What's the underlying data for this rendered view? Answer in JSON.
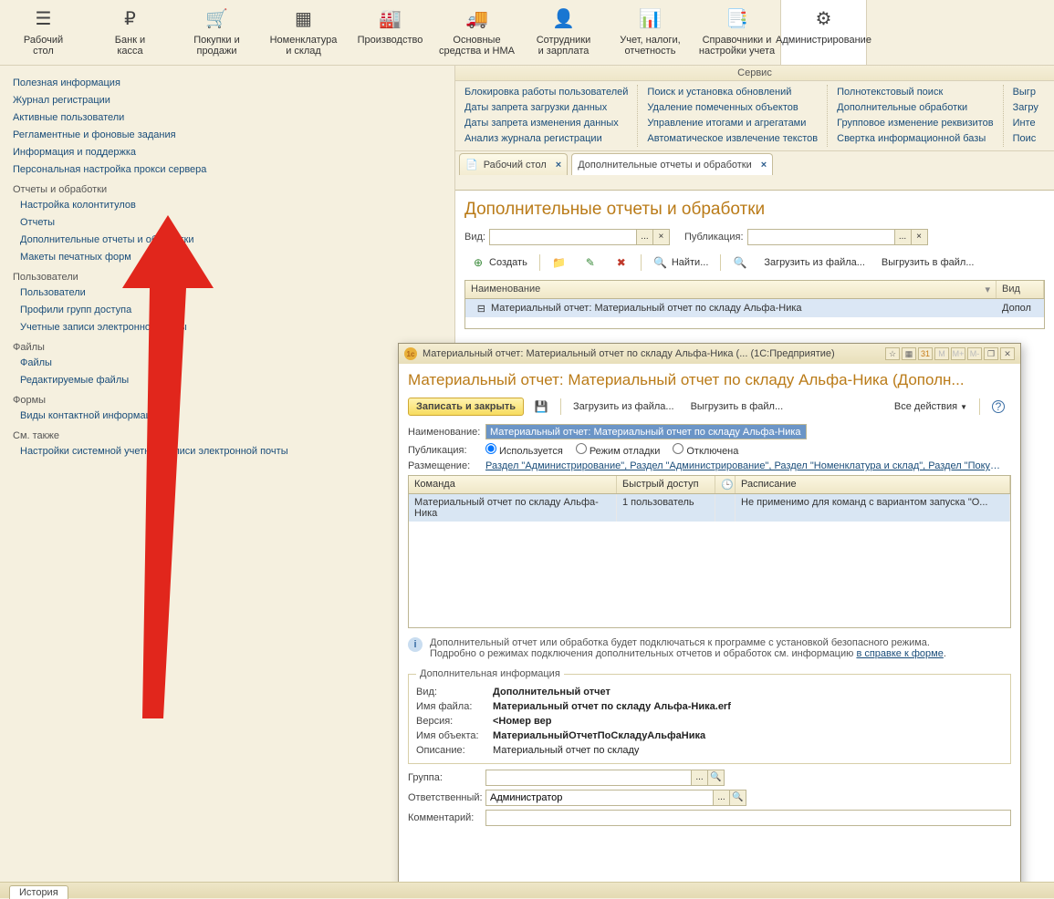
{
  "toolbar": [
    {
      "label": "Рабочий\nстол",
      "icon": "☰"
    },
    {
      "label": "Банк и\nкасса",
      "icon": "₽"
    },
    {
      "label": "Покупки и\nпродажи",
      "icon": "🛒"
    },
    {
      "label": "Номенклатура\nи склад",
      "icon": "▦"
    },
    {
      "label": "Производство",
      "icon": "🏭"
    },
    {
      "label": "Основные\nсредства и НМА",
      "icon": "🚚"
    },
    {
      "label": "Сотрудники\nи зарплата",
      "icon": "👤"
    },
    {
      "label": "Учет, налоги,\nотчетность",
      "icon": "📊"
    },
    {
      "label": "Справочники и\nнастройки учета",
      "icon": "📑"
    },
    {
      "label": "Администрирование",
      "icon": "⚙",
      "active": true
    }
  ],
  "left": {
    "top_links": [
      "Полезная информация",
      "Журнал регистрации",
      "Активные пользователи",
      "Регламентные и фоновые задания",
      "Информация и поддержка",
      "Персональная настройка прокси сервера"
    ],
    "groups": [
      {
        "title": "Отчеты и обработки",
        "items": [
          "Настройка колонтитулов",
          "Отчеты",
          "Дополнительные отчеты и обработки",
          "Макеты печатных форм"
        ]
      },
      {
        "title": "Пользователи",
        "items": [
          "Пользователи",
          "Профили групп доступа",
          "Учетные записи электронной почты"
        ]
      },
      {
        "title": "Файлы",
        "items": [
          "Файлы",
          "Редактируемые файлы"
        ]
      },
      {
        "title": "Формы",
        "items": [
          "Виды контактной информации"
        ]
      },
      {
        "title": "См. также",
        "items": [
          "Настройки системной учетной записи электронной почты"
        ]
      }
    ]
  },
  "service": {
    "header": "Сервис",
    "cols": [
      [
        "Блокировка работы пользователей",
        "Даты запрета загрузки данных",
        "Даты запрета изменения данных",
        "Анализ журнала регистрации"
      ],
      [
        "Поиск и установка обновлений",
        "Удаление помеченных объектов",
        "Управление итогами и агрегатами",
        "Автоматическое извлечение текстов"
      ],
      [
        "Полнотекстовый поиск",
        "Дополнительные обработки",
        "Групповое изменение реквизитов",
        "Свертка информационной базы"
      ],
      [
        "Выгр",
        "Загру",
        "Инте",
        "Поис"
      ]
    ]
  },
  "tabs": [
    {
      "label": "Рабочий стол",
      "icon": "📄"
    },
    {
      "label": "Дополнительные отчеты и обработки",
      "active": true
    }
  ],
  "page": {
    "title": "Дополнительные отчеты и обработки",
    "filters": {
      "vid_label": "Вид:",
      "pub_label": "Публикация:"
    },
    "toolbar": {
      "create": "Создать",
      "find": "Найти...",
      "load": "Загрузить из файла...",
      "export": "Выгрузить в файл..."
    },
    "grid": {
      "col_name": "Наименование",
      "col_vid": "Вид",
      "row_name": "Материальный отчет: Материальный отчет по складу Альфа-Ника",
      "row_vid": "Допол"
    }
  },
  "modal": {
    "titlebar": "Материальный отчет: Материальный отчет по складу Альфа-Ника (... (1С:Предприятие)",
    "tb_marks": [
      "M",
      "M+",
      "M-"
    ],
    "title": "Материальный отчет: Материальный отчет по складу Альфа-Ника (Дополн...",
    "save_btn": "Записать и закрыть",
    "load": "Загрузить из файла...",
    "export": "Выгрузить в файл...",
    "all_actions": "Все действия",
    "name_label": "Наименование:",
    "name_value": "Материальный отчет: Материальный отчет по складу Альфа-Ника",
    "pub_label": "Публикация:",
    "pub_opts": [
      "Используется",
      "Режим отладки",
      "Отключена"
    ],
    "place_label": "Размещение:",
    "place_value": "Раздел \"Администрирование\", Раздел \"Администрирование\", Раздел \"Номенклатура и склад\", Раздел \"Покуп...",
    "cmd_grid": {
      "h_cmd": "Команда",
      "h_access": "Быстрый доступ",
      "h_clock": "🕒",
      "h_sched": "Расписание",
      "r_cmd": "Материальный отчет по складу Альфа-Ника",
      "r_access": "1 пользователь",
      "r_sched": "Не применимо для команд с вариантом запуска \"О..."
    },
    "info_text1": "Дополнительный отчет или обработка будет подключаться к программе с установкой безопасного режима.",
    "info_text2a": "Подробно о режимах подключения дополнительных отчетов и обработок см. информацию ",
    "info_link": "в справке к форме",
    "info_text2b": ".",
    "fieldset_legend": "Дополнительная информация",
    "kv": [
      {
        "k": "Вид:",
        "v": "Дополнительный отчет",
        "bold": true
      },
      {
        "k": "Имя файла:",
        "v": "Материальный отчет по складу Альфа-Ника.erf",
        "bold": true
      },
      {
        "k": "Версия:",
        "v": "<Номер вер",
        "bold": true
      },
      {
        "k": "Имя объекта:",
        "v": "МатериальныйОтчетПоСкладуАльфаНика",
        "bold": true
      },
      {
        "k": "Описание:",
        "v": "Материальный отчет по складу",
        "bold": false
      }
    ],
    "group_label": "Группа:",
    "resp_label": "Ответственный:",
    "resp_value": "Администратор",
    "comm_label": "Комментарий:"
  },
  "footer": {
    "history": "История"
  }
}
